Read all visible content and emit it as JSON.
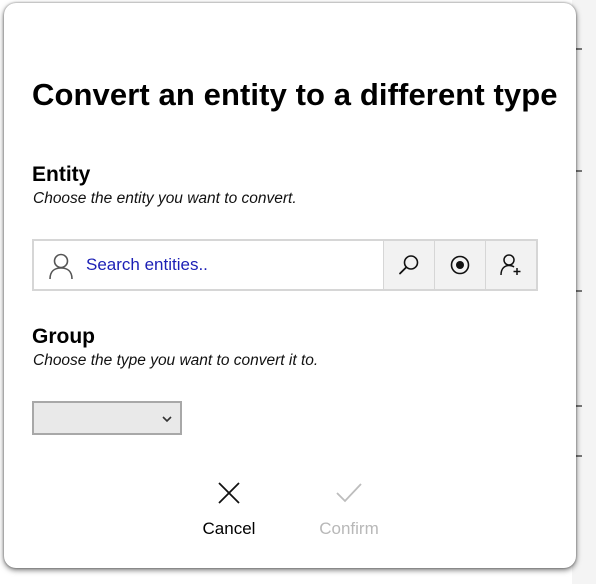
{
  "dialog": {
    "title": "Convert an entity to a different type"
  },
  "entity": {
    "heading": "Entity",
    "description": "Choose the entity you want to convert.",
    "search_placeholder": "Search entities..",
    "search_value": "",
    "buttons": [
      "search-icon",
      "target-icon",
      "add-person-icon"
    ]
  },
  "group": {
    "heading": "Group",
    "description": "Choose the type you want to convert it to.",
    "selected": ""
  },
  "actions": {
    "cancel_label": "Cancel",
    "confirm_label": "Confirm",
    "confirm_disabled": true
  },
  "colors": {
    "placeholder": "#1b1fb5",
    "disabled_text": "#b8b8b8"
  }
}
